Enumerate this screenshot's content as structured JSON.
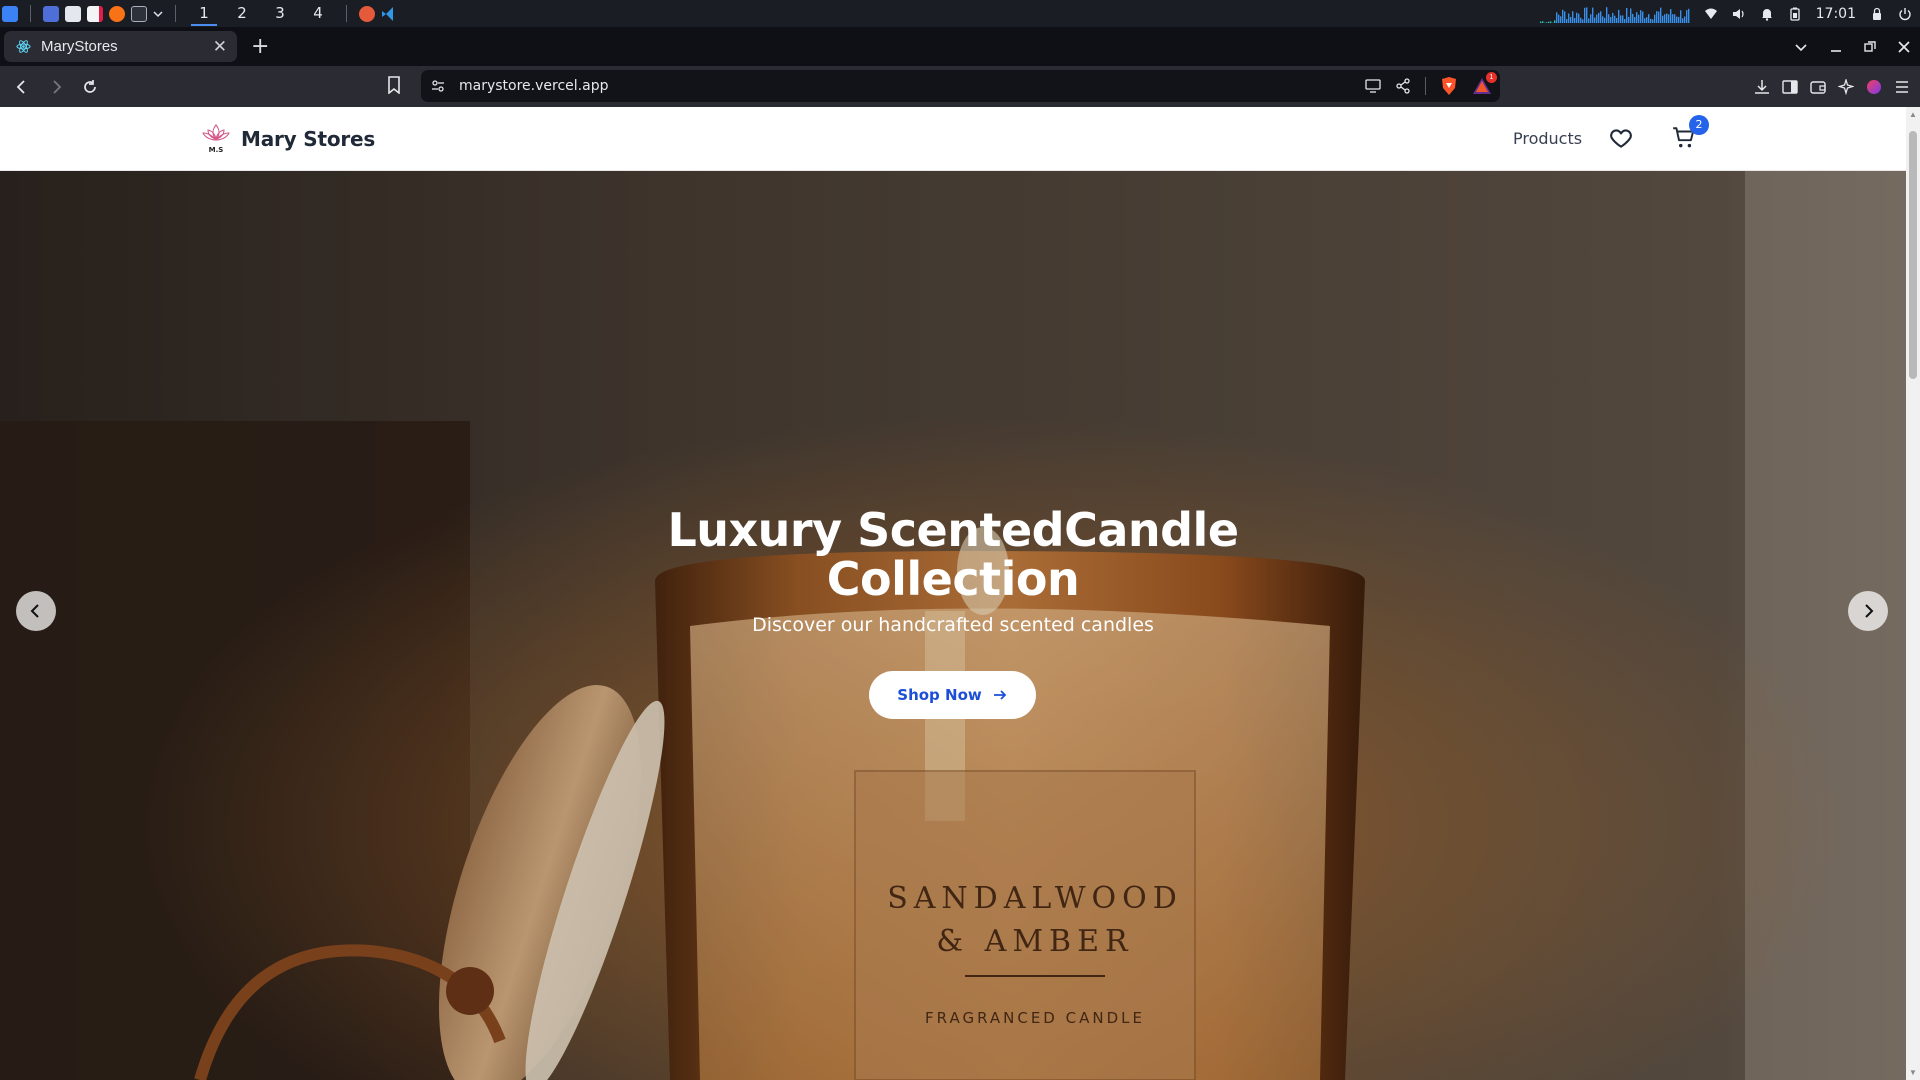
{
  "taskbar": {
    "workspaces": [
      "1",
      "2",
      "3",
      "4"
    ],
    "active_workspace": "1",
    "clock": "17:01",
    "tray_icons": [
      "network-graph",
      "wifi-icon",
      "volume-icon",
      "notification-bell-icon",
      "battery-icon",
      "lock-icon",
      "power-icon"
    ]
  },
  "browser": {
    "tab_title": "MaryStores",
    "url": "marystore.vercel.app",
    "brave_rewards_count": "1",
    "accent": "#2563eb"
  },
  "site": {
    "brand": "Mary Stores",
    "logo_initials": "M.S",
    "nav": {
      "products": "Products"
    },
    "cart_count": "2"
  },
  "hero": {
    "title_line1": "Luxury ScentedCandle",
    "title_line2": "Collection",
    "subtitle": "Discover our handcrafted scented candles",
    "cta_label": "Shop Now",
    "label_line1": "SANDALWOOD",
    "label_line2": "& AMBER",
    "label_line3": "FRAGRANCED CANDLE"
  }
}
